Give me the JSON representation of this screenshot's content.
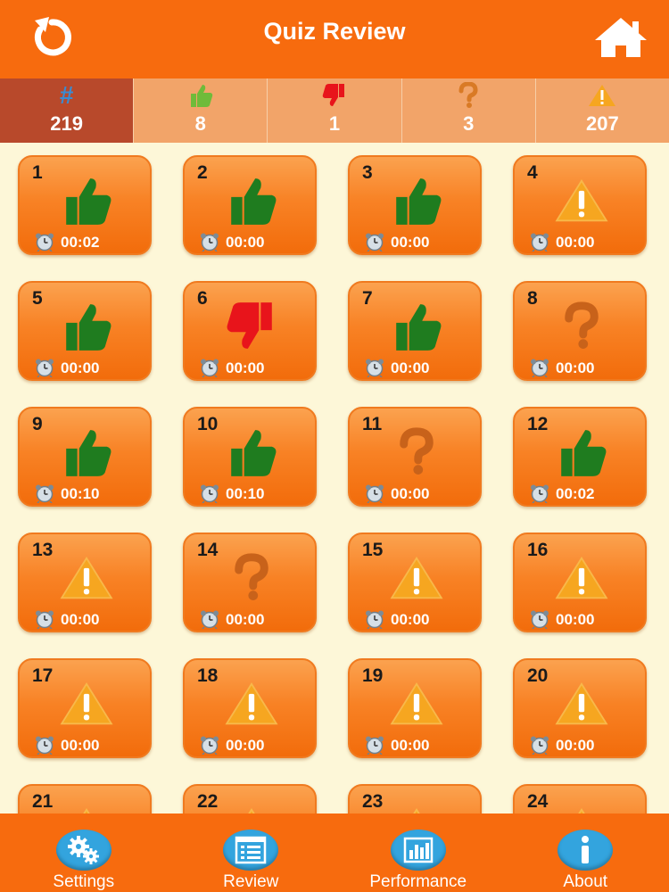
{
  "header": {
    "title": "Quiz Review"
  },
  "stats": {
    "total": {
      "symbol": "#",
      "value": "219"
    },
    "correct": {
      "value": "8"
    },
    "wrong": {
      "value": "1"
    },
    "unsure": {
      "value": "3"
    },
    "unanswered": {
      "value": "207"
    }
  },
  "colors": {
    "header": "#f76b0e",
    "correct": "#1f7c1f",
    "wrong": "#e8141b",
    "unanswered": "#f6a620",
    "tab_icon": "#33a4de"
  },
  "questions": [
    {
      "number": "1",
      "status": "correct",
      "time": "00:02"
    },
    {
      "number": "2",
      "status": "correct",
      "time": "00:00"
    },
    {
      "number": "3",
      "status": "correct",
      "time": "00:00"
    },
    {
      "number": "4",
      "status": "unanswered",
      "time": "00:00"
    },
    {
      "number": "5",
      "status": "correct",
      "time": "00:00"
    },
    {
      "number": "6",
      "status": "wrong",
      "time": "00:00"
    },
    {
      "number": "7",
      "status": "correct",
      "time": "00:00"
    },
    {
      "number": "8",
      "status": "unsure",
      "time": "00:00"
    },
    {
      "number": "9",
      "status": "correct",
      "time": "00:10"
    },
    {
      "number": "10",
      "status": "correct",
      "time": "00:10"
    },
    {
      "number": "11",
      "status": "unsure",
      "time": "00:00"
    },
    {
      "number": "12",
      "status": "correct",
      "time": "00:02"
    },
    {
      "number": "13",
      "status": "unanswered",
      "time": "00:00"
    },
    {
      "number": "14",
      "status": "unsure",
      "time": "00:00"
    },
    {
      "number": "15",
      "status": "unanswered",
      "time": "00:00"
    },
    {
      "number": "16",
      "status": "unanswered",
      "time": "00:00"
    },
    {
      "number": "17",
      "status": "unanswered",
      "time": "00:00"
    },
    {
      "number": "18",
      "status": "unanswered",
      "time": "00:00"
    },
    {
      "number": "19",
      "status": "unanswered",
      "time": "00:00"
    },
    {
      "number": "20",
      "status": "unanswered",
      "time": "00:00"
    },
    {
      "number": "21",
      "status": "unanswered",
      "time": ""
    },
    {
      "number": "22",
      "status": "unanswered",
      "time": ""
    },
    {
      "number": "23",
      "status": "unanswered",
      "time": ""
    },
    {
      "number": "24",
      "status": "unanswered",
      "time": ""
    }
  ],
  "tabs": [
    {
      "id": "settings",
      "label": "Settings",
      "icon": "gears-icon"
    },
    {
      "id": "review",
      "label": "Review",
      "icon": "list-icon"
    },
    {
      "id": "performance",
      "label": "Performance",
      "icon": "bar-chart-icon"
    },
    {
      "id": "about",
      "label": "About",
      "icon": "info-icon"
    }
  ]
}
